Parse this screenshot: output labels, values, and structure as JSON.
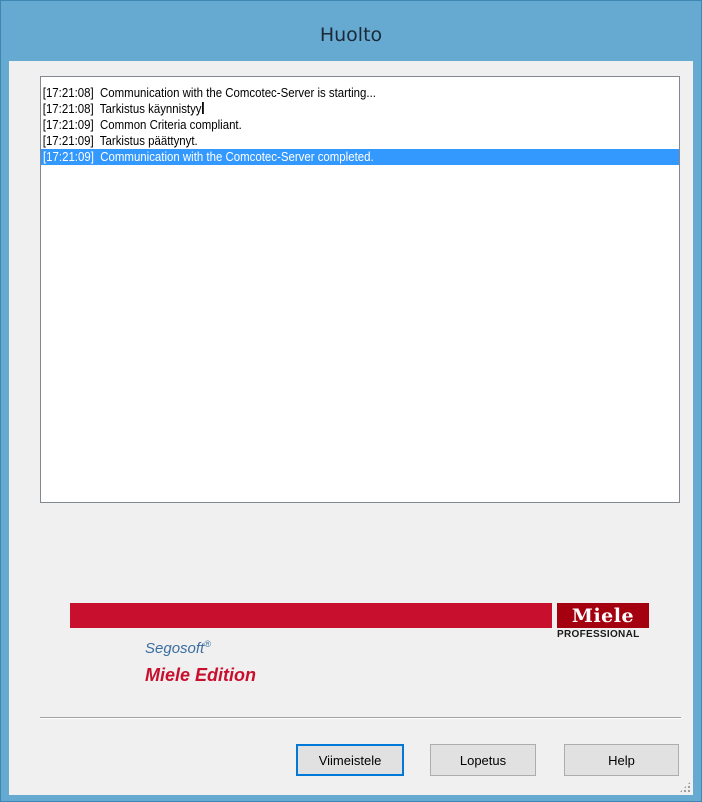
{
  "window": {
    "title": "Huolto"
  },
  "log": {
    "entries": [
      {
        "time": "[17:21:08]",
        "text": "Communication with the Comcotec-Server is starting...",
        "selected": false
      },
      {
        "time": "[17:21:08]",
        "text": "Tarkistus käynnistyy",
        "selected": false
      },
      {
        "time": "[17:21:09]",
        "text": "Common Criteria compliant.",
        "selected": false
      },
      {
        "time": "[17:21:09]",
        "text": "Tarkistus päättynyt.",
        "selected": false
      },
      {
        "time": "[17:21:09]",
        "text": "Communication with the Comcotec-Server completed.",
        "selected": true
      }
    ]
  },
  "branding": {
    "logo_text": "Miele",
    "logo_subtitle": "PROFESSIONAL",
    "product": "Segosoft",
    "product_mark": "®",
    "edition": "Miele Edition",
    "colors": {
      "brand_red": "#c8102e",
      "logo_dark_red": "#a5000f",
      "product_blue": "#3b6e9e",
      "selection": "#3399ff",
      "titlebar": "#66a9d1"
    }
  },
  "buttons": {
    "finish": "Viimeistele",
    "cancel": "Lopetus",
    "help": "Help"
  }
}
